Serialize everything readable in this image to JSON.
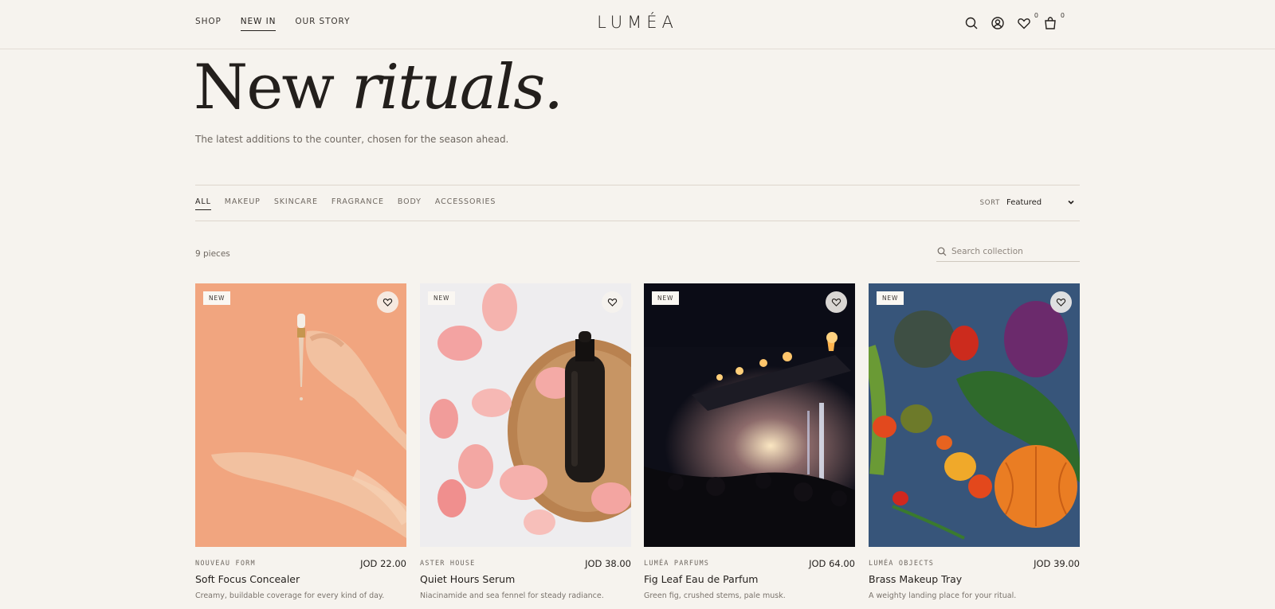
{
  "header": {
    "nav": [
      "SHOP",
      "NEW IN",
      "OUR STORY"
    ],
    "logo": "LUMÉA",
    "wishlist_count": "0",
    "cart_count": "0"
  },
  "hero": {
    "title_plain": "New ",
    "title_italic": "rituals.",
    "subtitle": "The latest additions to the counter, chosen for the season ahead."
  },
  "filters": {
    "categories": [
      "ALL",
      "MAKEUP",
      "SKINCARE",
      "FRAGRANCE",
      "BODY",
      "ACCESSORIES"
    ],
    "sort_label": "SORT",
    "sort_value": "Featured"
  },
  "listing": {
    "count": "9 pieces",
    "search_placeholder": "Search collection"
  },
  "products": [
    {
      "badge": "NEW",
      "brand": "NOUVEAU FORM",
      "price": "JOD 22.00",
      "name": "Soft Focus Concealer",
      "desc": "Creamy, buildable coverage for every kind of day."
    },
    {
      "badge": "NEW",
      "brand": "ASTER HOUSE",
      "price": "JOD 38.00",
      "name": "Quiet Hours Serum",
      "desc": "Niacinamide and sea fennel for steady radiance."
    },
    {
      "badge": "NEW",
      "brand": "LUMÉA PARFUMS",
      "price": "JOD 64.00",
      "name": "Fig Leaf Eau de Parfum",
      "desc": "Green fig, crushed stems, pale musk."
    },
    {
      "badge": "NEW",
      "brand": "LUMÉA OBJECTS",
      "price": "JOD 39.00",
      "name": "Brass Makeup Tray",
      "desc": "A weighty landing place for your ritual."
    }
  ]
}
